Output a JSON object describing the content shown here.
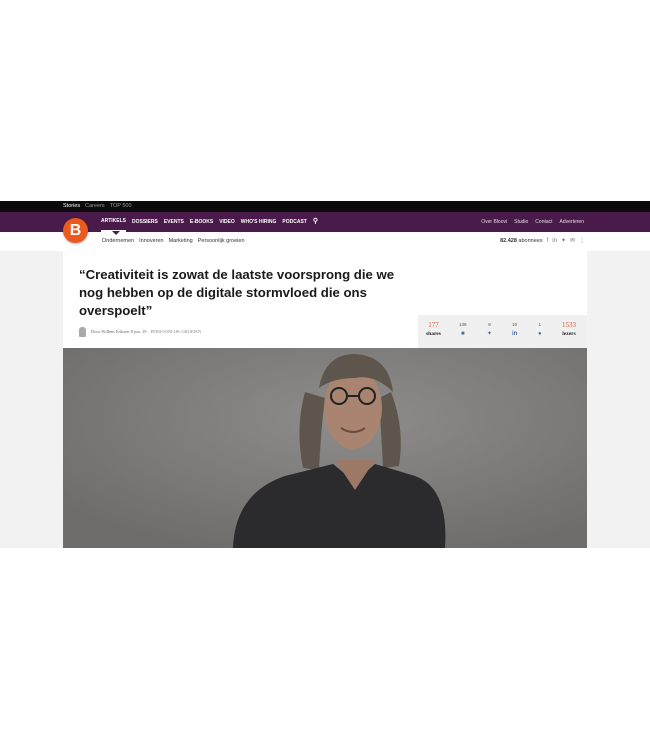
{
  "topbar": {
    "links": [
      "Stories",
      "Careers",
      "TOP 500"
    ]
  },
  "nav": {
    "items": [
      "ARTIKELS",
      "DOSSIERS",
      "EVENTS",
      "E-BOOKS",
      "VIDEO",
      "WHO'S HIRING",
      "PODCAST"
    ],
    "right": [
      "Over Bloovi",
      "Studio",
      "Contact",
      "Adverteren"
    ]
  },
  "logo": {
    "letter": "B"
  },
  "subnav": {
    "categories": [
      "Ondernemen",
      "Innoveren",
      "Marketing",
      "Persoonlijk groeien"
    ],
    "subscribers_count": "82.428",
    "subscribers_label": "abonnees"
  },
  "article": {
    "title": "“Creativiteit is zowat de laatste voorsprong die we nog hebben op de digitale stormvloed die ons overspoelt”",
    "author": "Door Willem Eriksen",
    "date": "8 jun. 19",
    "category": "PERSOONLIJK GROEIEN"
  },
  "shares": {
    "total": "177",
    "total_label": "shares",
    "facebook": "138",
    "twitter": "8",
    "linkedin": "10",
    "messenger": "1",
    "readers": "1533",
    "readers_label": "lezers"
  },
  "colors": {
    "brand": "#ea5a1e",
    "nav": "#4a1a4a",
    "accent": "#d4572a"
  }
}
